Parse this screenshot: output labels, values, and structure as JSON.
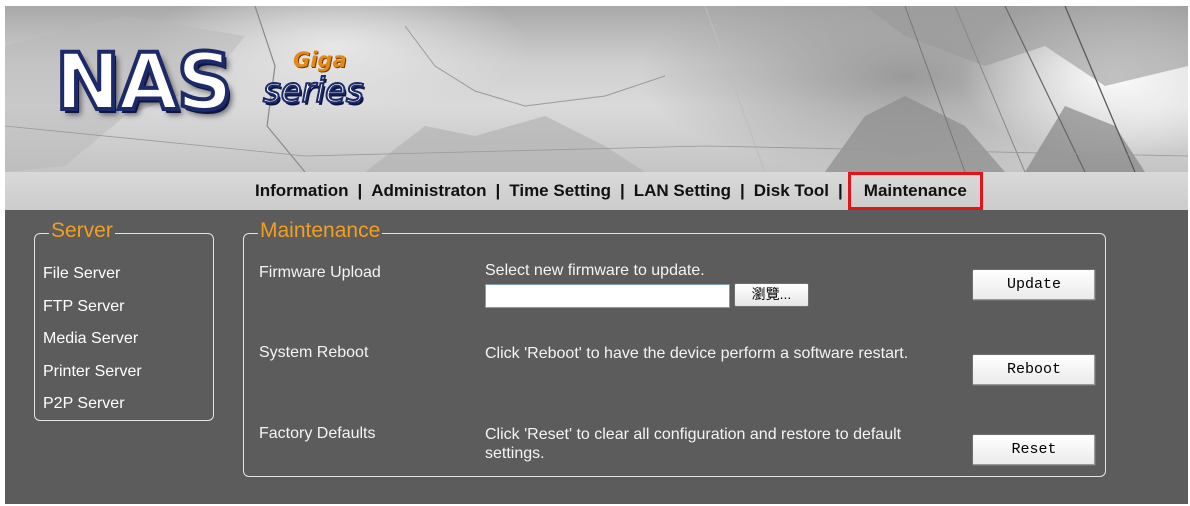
{
  "logo": {
    "brand": "NAS",
    "tag_top": "Giga",
    "tag_bottom": "series"
  },
  "nav": {
    "items": [
      {
        "label": "Information"
      },
      {
        "label": "Administraton"
      },
      {
        "label": "Time Setting"
      },
      {
        "label": "LAN Setting"
      },
      {
        "label": "Disk Tool"
      },
      {
        "label": "Maintenance",
        "active": true
      }
    ],
    "separator": "|"
  },
  "sidebar": {
    "legend": "Server",
    "items": [
      {
        "label": "File Server"
      },
      {
        "label": "FTP Server"
      },
      {
        "label": "Media Server"
      },
      {
        "label": "Printer Server"
      },
      {
        "label": "P2P Server"
      }
    ]
  },
  "maintenance": {
    "legend": "Maintenance",
    "firmware": {
      "label": "Firmware Upload",
      "description": "Select new firmware to update.",
      "file_value": "",
      "browse_label": "瀏覽...",
      "button_label": "Update"
    },
    "reboot": {
      "label": "System Reboot",
      "description": "Click 'Reboot' to have the device perform a software restart.",
      "button_label": "Reboot"
    },
    "reset": {
      "label": "Factory Defaults",
      "description": "Click 'Reset' to clear all configuration and restore to default settings.",
      "button_label": "Reset"
    }
  },
  "colors": {
    "accent_orange": "#f0a020",
    "active_outline": "#e3131b",
    "panel_bg": "#5c5c5c",
    "nav_bg": "#d2d2d2",
    "logo_blue": "#1c2a6a"
  }
}
